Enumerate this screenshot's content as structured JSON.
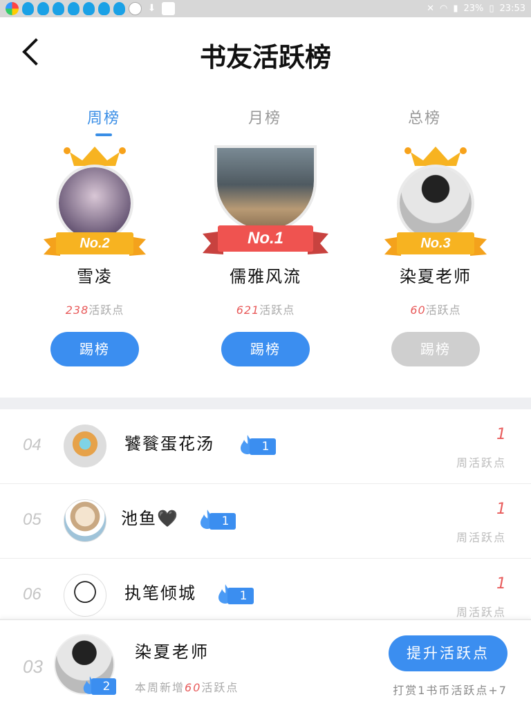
{
  "status_bar": {
    "battery": "23%",
    "time": "23:53"
  },
  "header": {
    "title": "书友活跃榜"
  },
  "tabs": [
    {
      "label": "周榜",
      "active": true
    },
    {
      "label": "月榜",
      "active": false
    },
    {
      "label": "总榜",
      "active": false
    }
  ],
  "podium": {
    "first": {
      "rank": "No.1",
      "name": "儒雅风流",
      "points": "621",
      "points_suffix": "活跃点",
      "button": "踢榜",
      "button_enabled": true
    },
    "second": {
      "rank": "No.2",
      "name": "雪凌",
      "points": "238",
      "points_suffix": "活跃点",
      "button": "踢榜",
      "button_enabled": true
    },
    "third": {
      "rank": "No.3",
      "name": "染夏老师",
      "points": "60",
      "points_suffix": "活跃点",
      "button": "踢榜",
      "button_enabled": false
    }
  },
  "list": [
    {
      "rank": "04",
      "name": "饕餮蛋花汤",
      "badge": "1",
      "score": "1",
      "score_label": "周活跃点"
    },
    {
      "rank": "05",
      "name": "池鱼🖤",
      "badge": "1",
      "score": "1",
      "score_label": "周活跃点"
    },
    {
      "rank": "06",
      "name": "执笔倾城",
      "badge": "1",
      "score": "1",
      "score_label": "周活跃点"
    }
  ],
  "me": {
    "rank": "03",
    "name": "染夏老师",
    "badge": "2",
    "sub_prefix": "本周新增",
    "sub_points": "60",
    "sub_suffix": "活跃点",
    "button": "提升活跃点",
    "tip": "打赏1书币活跃点+7"
  },
  "colors": {
    "accent": "#3b8ef0",
    "score": "#e85a5a",
    "gold": "#f7b321",
    "red_ribbon": "#ef5350",
    "disabled": "#cfcfcf"
  }
}
